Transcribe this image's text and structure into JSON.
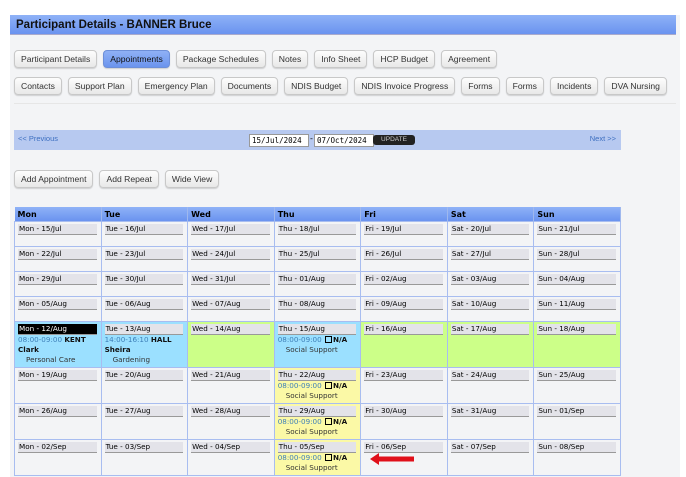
{
  "header": {
    "title": "Participant Details - BANNER Bruce"
  },
  "tabs_row1": [
    {
      "label": "Participant Details"
    },
    {
      "label": "Appointments",
      "active": true
    },
    {
      "label": "Package Schedules"
    },
    {
      "label": "Notes"
    },
    {
      "label": "Info Sheet"
    },
    {
      "label": "HCP Budget"
    },
    {
      "label": "Agreement"
    }
  ],
  "tabs_row2": [
    {
      "label": "Contacts"
    },
    {
      "label": "Support Plan"
    },
    {
      "label": "Emergency Plan"
    },
    {
      "label": "Documents"
    },
    {
      "label": "NDIS Budget"
    },
    {
      "label": "NDIS Invoice Progress"
    },
    {
      "label": "Forms"
    },
    {
      "label": "Forms"
    },
    {
      "label": "Incidents"
    },
    {
      "label": "DVA Nursing"
    }
  ],
  "nav": {
    "previous": "<< Previous",
    "next": "Next >>",
    "from": "15/Jul/2024",
    "to": "07/Oct/2024",
    "sep": "-",
    "update": "UPDATE"
  },
  "actions": {
    "add_appointment": "Add Appointment",
    "add_repeat": "Add Repeat",
    "wide_view": "Wide View"
  },
  "calendar": {
    "headers": [
      "Mon",
      "Tue",
      "Wed",
      "Thu",
      "Fri",
      "Sat",
      "Sun"
    ],
    "colors": {
      "blue": "#9be0ff",
      "green": "#ccff88",
      "yellow": "#fbf9a6"
    },
    "weeks": [
      {
        "days": [
          {
            "label": "Mon - 15/Jul"
          },
          {
            "label": "Tue - 16/Jul"
          },
          {
            "label": "Wed - 17/Jul"
          },
          {
            "label": "Thu - 18/Jul"
          },
          {
            "label": "Fri - 19/Jul"
          },
          {
            "label": "Sat - 20/Jul"
          },
          {
            "label": "Sun - 21/Jul"
          }
        ]
      },
      {
        "days": [
          {
            "label": "Mon - 22/Jul"
          },
          {
            "label": "Tue - 23/Jul"
          },
          {
            "label": "Wed - 24/Jul"
          },
          {
            "label": "Thu - 25/Jul"
          },
          {
            "label": "Fri - 26/Jul"
          },
          {
            "label": "Sat - 27/Jul"
          },
          {
            "label": "Sun - 28/Jul"
          }
        ]
      },
      {
        "days": [
          {
            "label": "Mon - 29/Jul"
          },
          {
            "label": "Tue - 30/Jul"
          },
          {
            "label": "Wed - 31/Jul"
          },
          {
            "label": "Thu - 01/Aug"
          },
          {
            "label": "Fri - 02/Aug"
          },
          {
            "label": "Sat - 03/Aug"
          },
          {
            "label": "Sun - 04/Aug"
          }
        ]
      },
      {
        "days": [
          {
            "label": "Mon - 05/Aug"
          },
          {
            "label": "Tue - 06/Aug"
          },
          {
            "label": "Wed - 07/Aug"
          },
          {
            "label": "Thu - 08/Aug"
          },
          {
            "label": "Fri - 09/Aug"
          },
          {
            "label": "Sat - 10/Aug"
          },
          {
            "label": "Sun - 11/Aug"
          }
        ]
      },
      {
        "days": [
          {
            "label": "Mon - 12/Aug",
            "color": "blue",
            "selected": true,
            "appointments": [
              {
                "time": "08:00-09:00",
                "who": "KENT Clark",
                "service": "Personal Care"
              }
            ]
          },
          {
            "label": "Tue - 13/Aug",
            "color": "blue",
            "appointments": [
              {
                "time": "14:00-16:10",
                "who": "HALL Sheira",
                "service": "Gardening"
              }
            ]
          },
          {
            "label": "Wed - 14/Aug",
            "color": "green"
          },
          {
            "label": "Thu - 15/Aug",
            "color": "blue",
            "appointments": [
              {
                "time": "08:00-09:00",
                "checkbox": true,
                "who": "N/A",
                "service": "Social Support"
              }
            ]
          },
          {
            "label": "Fri - 16/Aug",
            "color": "green"
          },
          {
            "label": "Sat - 17/Aug",
            "color": "green"
          },
          {
            "label": "Sun - 18/Aug",
            "color": "green"
          }
        ]
      },
      {
        "days": [
          {
            "label": "Mon - 19/Aug"
          },
          {
            "label": "Tue - 20/Aug"
          },
          {
            "label": "Wed - 21/Aug"
          },
          {
            "label": "Thu - 22/Aug",
            "color": "yellow",
            "appointments": [
              {
                "time": "08:00-09:00",
                "checkbox": true,
                "who": "N/A",
                "service": "Social Support"
              }
            ]
          },
          {
            "label": "Fri - 23/Aug"
          },
          {
            "label": "Sat - 24/Aug"
          },
          {
            "label": "Sun - 25/Aug"
          }
        ]
      },
      {
        "days": [
          {
            "label": "Mon - 26/Aug"
          },
          {
            "label": "Tue - 27/Aug"
          },
          {
            "label": "Wed - 28/Aug"
          },
          {
            "label": "Thu - 29/Aug",
            "color": "yellow",
            "appointments": [
              {
                "time": "08:00-09:00",
                "checkbox": true,
                "who": "N/A",
                "service": "Social Support"
              }
            ]
          },
          {
            "label": "Fri - 30/Aug"
          },
          {
            "label": "Sat - 31/Aug"
          },
          {
            "label": "Sun - 01/Sep"
          }
        ]
      },
      {
        "days": [
          {
            "label": "Mon - 02/Sep"
          },
          {
            "label": "Tue - 03/Sep"
          },
          {
            "label": "Wed - 04/Sep"
          },
          {
            "label": "Thu - 05/Sep",
            "color": "yellow",
            "appointments": [
              {
                "time": "08:00-09:00",
                "checkbox": true,
                "who": "N/A",
                "service": "Social Support"
              }
            ]
          },
          {
            "label": "Fri - 06/Sep"
          },
          {
            "label": "Sat - 07/Sep"
          },
          {
            "label": "Sun - 08/Sep"
          }
        ]
      }
    ]
  },
  "annotation": {
    "icon": "red-arrow-left",
    "color": "#e0101a"
  }
}
